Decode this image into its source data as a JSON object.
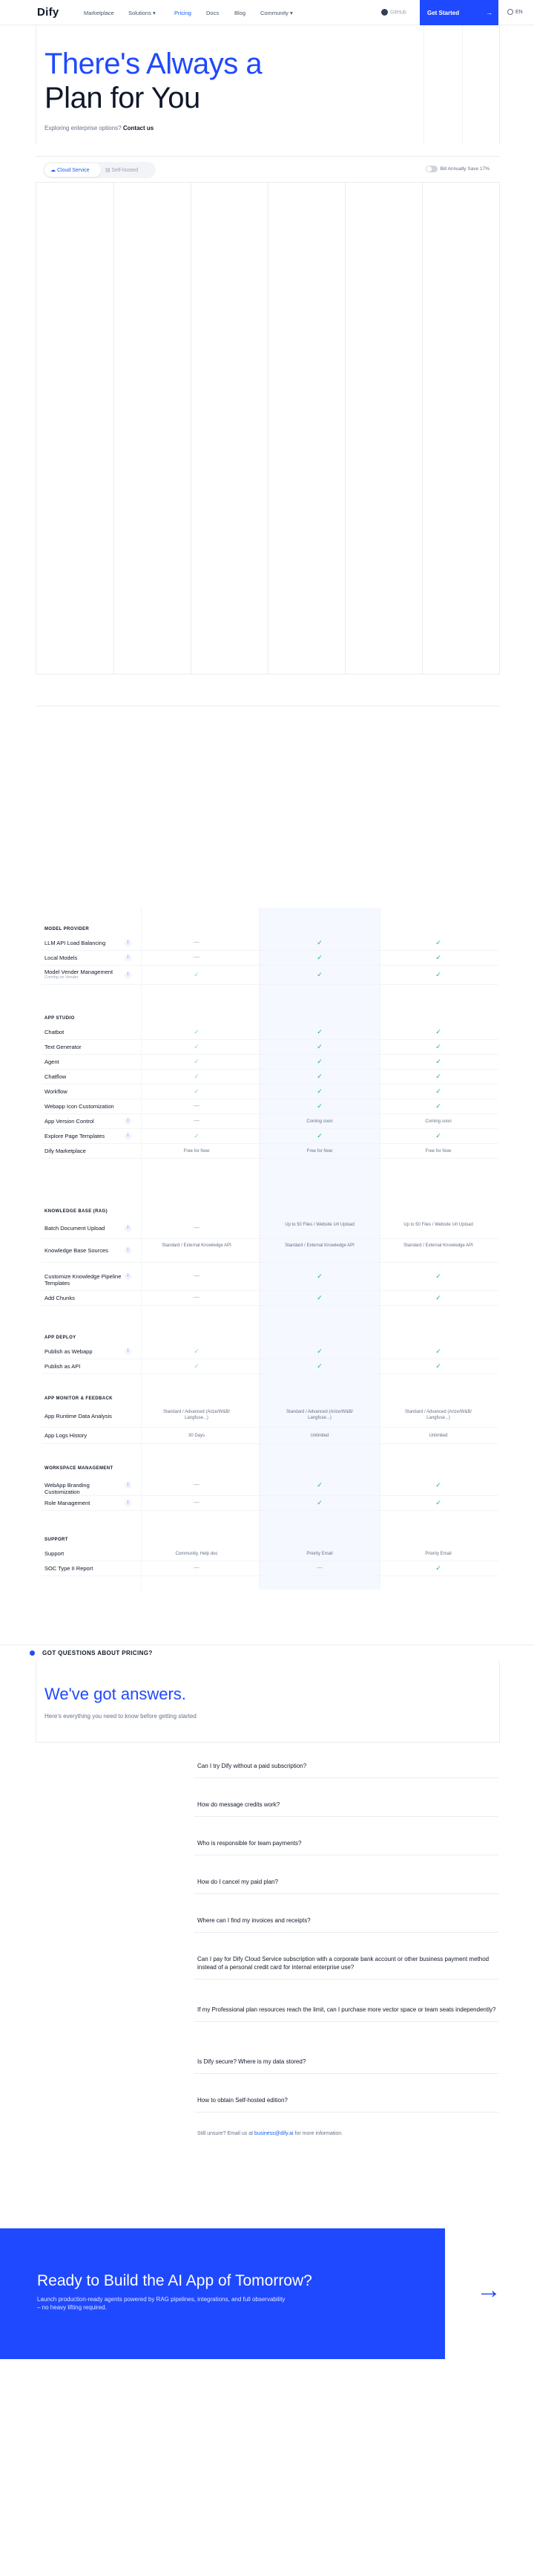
{
  "nav": {
    "logo": "Dify",
    "links": [
      "Marketplace",
      "Solutions",
      "Pricing",
      "Docs",
      "Blog",
      "Community"
    ],
    "github_label": "GitHub",
    "cta_label": "Get Started",
    "language": "EN"
  },
  "hero": {
    "title_line1": "There's Always a",
    "title_line2": "Plan for You",
    "subtitle": "Exploring enterprise options?",
    "contact_link": "Contact us"
  },
  "pricing_toggle": {
    "options": [
      "Cloud Service",
      "Self-hosted"
    ],
    "selected": "Cloud Service",
    "billing_label": "Bill Annually Save 17%"
  },
  "comparison": {
    "sections": [
      {
        "title": "MODEL PROVIDER",
        "rows": [
          {
            "label": "LLM API Load Balancing",
            "info": true,
            "values": [
              "dash",
              "check",
              "check"
            ]
          },
          {
            "label": "Local Models",
            "info": true,
            "values": [
              "dash",
              "check",
              "check"
            ]
          },
          {
            "label": "Model Vender Management",
            "sub": "Coming on Vender",
            "info": true,
            "values": [
              "check-lite",
              "check",
              "check"
            ]
          }
        ]
      },
      {
        "title": "APP STUDIO",
        "rows": [
          {
            "label": "Chatbot",
            "values": [
              "check-lite",
              "check",
              "check"
            ]
          },
          {
            "label": "Text Generator",
            "values": [
              "check-lite",
              "check",
              "check"
            ]
          },
          {
            "label": "Agent",
            "values": [
              "check-lite",
              "check",
              "check"
            ]
          },
          {
            "label": "Chatflow",
            "values": [
              "check-lite",
              "check",
              "check"
            ]
          },
          {
            "label": "Workflow",
            "values": [
              "check-lite",
              "check",
              "check"
            ]
          },
          {
            "label": "Webapp Icon Customization",
            "values": [
              "dash",
              "check",
              "check"
            ]
          },
          {
            "label": "App Version Control",
            "info": true,
            "values": [
              "dash",
              "Coming soon",
              "Coming soon"
            ]
          },
          {
            "label": "Explore Page Templates",
            "info": true,
            "values": [
              "check-lite",
              "check",
              "check"
            ]
          },
          {
            "label": "Dify Marketplace",
            "values": [
              "Free for Now",
              "Free for Now",
              "Free for Now"
            ]
          }
        ]
      },
      {
        "title": "KNOWLEDGE BASE (RAG)",
        "rows": [
          {
            "label": "Batch Document Upload",
            "info": true,
            "values": [
              "dash",
              "Up to 50 Files / Website Url Upload",
              "Up to 50 Files / Website Url Upload"
            ]
          },
          {
            "label": "Knowledge Base Sources",
            "info": true,
            "values": [
              "Standard / External Knowledge API",
              "Standard / External Knowledge API",
              "Standard / External Knowledge API"
            ]
          },
          {
            "label": "Customize Knowledge Pipeline Templates",
            "info": true,
            "values": [
              "dash",
              "check",
              "check"
            ]
          },
          {
            "label": "Add Chunks",
            "values": [
              "dash",
              "check",
              "check"
            ]
          }
        ]
      },
      {
        "title": "APP DEPLOY",
        "rows": [
          {
            "label": "Publish as Webapp",
            "info": true,
            "values": [
              "check-lite",
              "check",
              "check"
            ]
          },
          {
            "label": "Publish as API",
            "values": [
              "check-lite",
              "check",
              "check"
            ]
          }
        ]
      },
      {
        "title": "APP MONITOR & FEEDBACK",
        "rows": [
          {
            "label": "App Runtime Data Analysis",
            "values": [
              "Standard / Advanced (Arize/W&B/ Langfuse...)",
              "Standard / Advanced (Arize/W&B/ Langfuse...)",
              "Standard / Advanced (Arize/W&B/ Langfuse...)"
            ]
          },
          {
            "label": "App Logs History",
            "values": [
              "30 Days",
              "Unlimited",
              "Unlimited"
            ]
          }
        ]
      },
      {
        "title": "WORKSPACE MANAGEMENT",
        "rows": [
          {
            "label": "WebApp Branding Customization",
            "info": true,
            "values": [
              "dash",
              "check",
              "check"
            ]
          },
          {
            "label": "Role Management",
            "info": true,
            "values": [
              "dash",
              "check",
              "check"
            ]
          }
        ]
      },
      {
        "title": "SUPPORT",
        "rows": [
          {
            "label": "Support",
            "values": [
              "Community, Help doc",
              "Priority Email",
              "Priority Email"
            ]
          },
          {
            "label": "SOC Type II Report",
            "values": [
              "dash",
              "dash",
              "check"
            ]
          }
        ]
      }
    ]
  },
  "faq": {
    "label": "GOT QUESTIONS ABOUT PRICING?",
    "title": "We've got answers.",
    "subtitle": "Here's everything you need to know before getting started",
    "questions": [
      "Can I try Dify without a paid subscription?",
      "How do message credits work?",
      "Who is responsible for team payments?",
      "How do I cancel my paid plan?",
      "Where can I find my invoices and receipts?",
      "Can I pay for Dify Cloud Service subscription with a corporate bank account or other business payment method instead of a personal credit card for internal enterprise use?",
      "If my Professional plan resources reach the limit, can I purchase more vector space or team seats independently?",
      "Is Dify secure? Where is my data stored?",
      "How to obtain Self-hosted edition?"
    ],
    "footer_prefix": "Still unsure? Email us at",
    "footer_email": "business@dify.ai",
    "footer_suffix": "for more information."
  },
  "cta": {
    "title": "Ready to Build the AI App of Tomorrow?",
    "subtitle": "Launch production-ready agents powered by RAG pipelines, integrations, and full observability – no heavy lifting required.",
    "arrow_icon": "arrow-right-icon"
  },
  "colors": {
    "brand": "#1f49ff",
    "check": "#12b76a"
  }
}
